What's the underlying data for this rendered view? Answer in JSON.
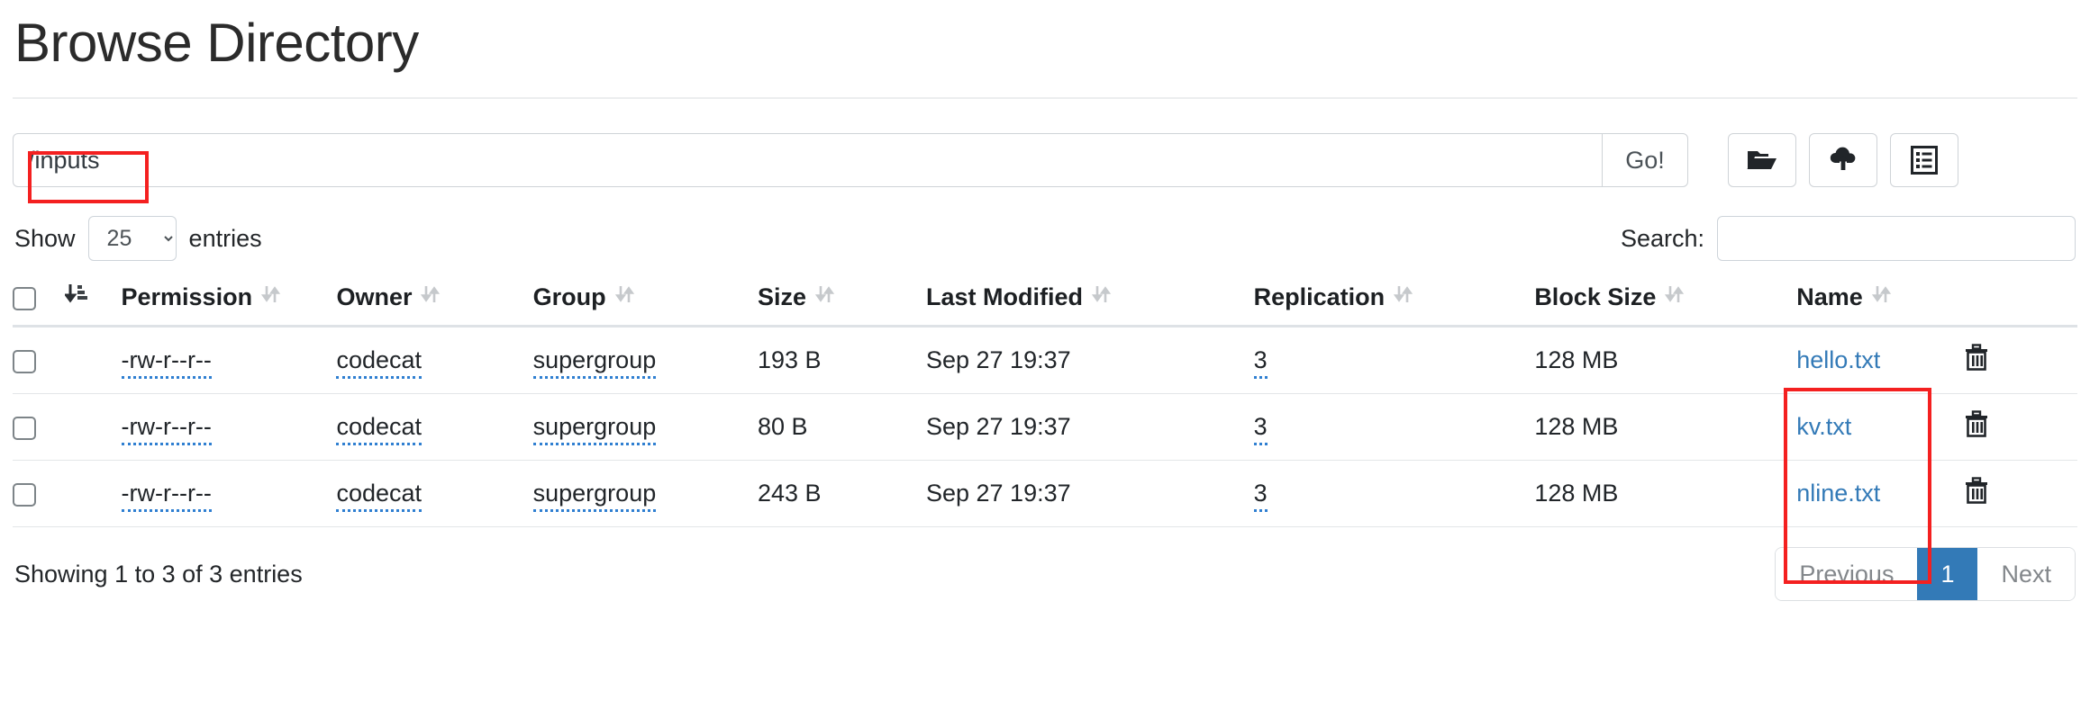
{
  "page": {
    "title": "Browse Directory"
  },
  "pathbar": {
    "path_value": "/inputs",
    "path_placeholder": "",
    "go_label": "Go!",
    "buttons": [
      {
        "name": "create-directory-button",
        "icon": "folder-open-icon"
      },
      {
        "name": "upload-file-button",
        "icon": "cloud-upload-icon"
      },
      {
        "name": "cut-high-availability-button",
        "icon": "list-alt-icon"
      }
    ]
  },
  "controls": {
    "show_label": "Show",
    "entries_label": "entries",
    "entries_value": "25",
    "entries_options": [
      "25"
    ],
    "search_label": "Search:",
    "search_value": "",
    "search_placeholder": ""
  },
  "table": {
    "headers": [
      {
        "label": "",
        "icon": "select-all-checkbox",
        "sort": "none"
      },
      {
        "label": "",
        "icon": "sort-amount-down-icon",
        "sort": "active"
      },
      {
        "label": "Permission",
        "sort": "both"
      },
      {
        "label": "Owner",
        "sort": "both"
      },
      {
        "label": "Group",
        "sort": "both"
      },
      {
        "label": "Size",
        "sort": "both"
      },
      {
        "label": "Last Modified",
        "sort": "both"
      },
      {
        "label": "Replication",
        "sort": "both"
      },
      {
        "label": "Block Size",
        "sort": "both"
      },
      {
        "label": "Name",
        "sort": "both"
      },
      {
        "label": "",
        "sort": "none"
      }
    ],
    "rows": [
      {
        "permission": "-rw-r--r--",
        "owner": "codecat",
        "group": "supergroup",
        "size": "193 B",
        "modified": "Sep 27 19:37",
        "replication": "3",
        "block_size": "128 MB",
        "name": "hello.txt",
        "delete_icon": "trash-icon"
      },
      {
        "permission": "-rw-r--r--",
        "owner": "codecat",
        "group": "supergroup",
        "size": "80 B",
        "modified": "Sep 27 19:37",
        "replication": "3",
        "block_size": "128 MB",
        "name": "kv.txt",
        "delete_icon": "trash-icon"
      },
      {
        "permission": "-rw-r--r--",
        "owner": "codecat",
        "group": "supergroup",
        "size": "243 B",
        "modified": "Sep 27 19:37",
        "replication": "3",
        "block_size": "128 MB",
        "name": "nline.txt",
        "delete_icon": "trash-icon"
      }
    ]
  },
  "footer": {
    "info": "Showing 1 to 3 of 3 entries",
    "previous_label": "Previous",
    "page_label": "1",
    "next_label": "Next"
  },
  "annotations": [
    {
      "name": "path-highlight",
      "target": "/inputs"
    },
    {
      "name": "name-column-highlight",
      "target": "Name column file links"
    }
  ],
  "colors": {
    "link_blue": "#337ab7",
    "active_page_bg": "#337ab7",
    "annotation_red": "#f42020",
    "editable_underline": "#2f7fd1",
    "border_grey": "#dee2e6"
  }
}
